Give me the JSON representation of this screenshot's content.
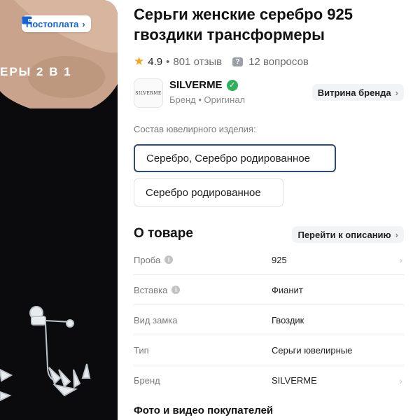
{
  "gallery": {
    "postpay_label": "Постоплата",
    "caption": "ЕРЫ 2 В 1"
  },
  "product": {
    "title": "Серьги женские серебро 925 гвоздики трансформеры",
    "rating": "4.9",
    "separator": "•",
    "reviews": "801 отзыв",
    "questions": "12 вопросов"
  },
  "brand": {
    "logo_text": "SILVERME",
    "name": "SILVERME",
    "subtitle": "Бренд • Оригинал",
    "store_label": "Витрина бренда"
  },
  "composition": {
    "label": "Состав ювелирного изделия:",
    "options": [
      {
        "label": "Серебро, Серебро родированное",
        "selected": true
      },
      {
        "label": "Серебро родированное",
        "selected": false
      }
    ]
  },
  "about": {
    "title": "О товаре",
    "to_description_label": "Перейти к описанию",
    "specs": [
      {
        "key": "Проба",
        "value": "925",
        "has_info": true,
        "has_arrow": true
      },
      {
        "key": "Вставка",
        "value": "Фианит",
        "has_info": true,
        "has_arrow": false
      },
      {
        "key": "Вид замка",
        "value": "Гвоздик",
        "has_info": false,
        "has_arrow": false
      },
      {
        "key": "Тип",
        "value": "Серьги ювелирные",
        "has_info": false,
        "has_arrow": false
      },
      {
        "key": "Бренд",
        "value": "SILVERME",
        "has_info": false,
        "has_arrow": true
      }
    ]
  },
  "customer_media": {
    "title": "Фото и видео покупателей"
  },
  "colors": {
    "accent_blue": "#1464d8",
    "selected_border": "#2c4b6e",
    "star": "#f5a623",
    "verified": "#2fb05a"
  },
  "icons": {
    "postpay": "wallet-icon",
    "star": "star-icon",
    "questions": "question-chat-icon",
    "verified": "check-circle-icon",
    "info": "info-icon",
    "chevron": "chevron-right-icon"
  }
}
